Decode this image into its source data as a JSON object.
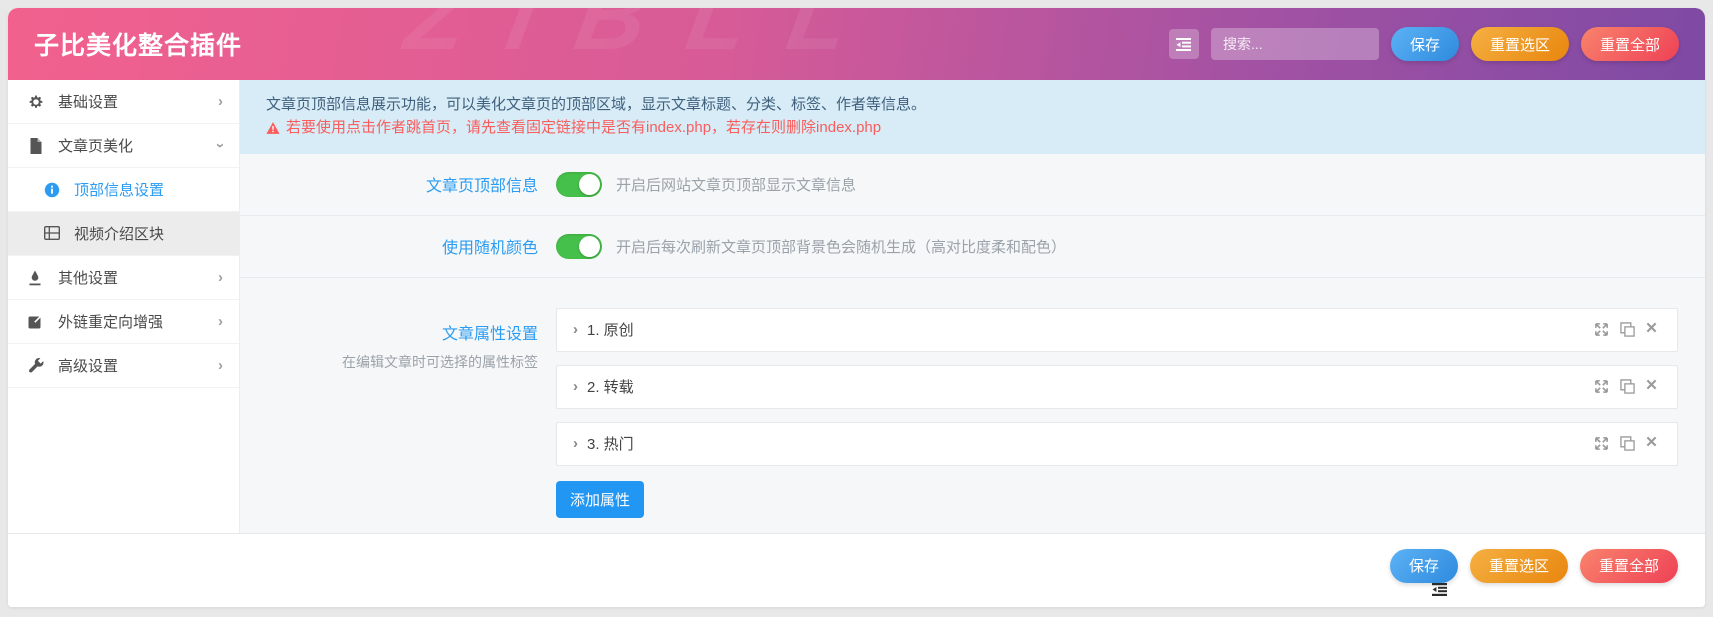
{
  "header": {
    "title": "子比美化整合插件",
    "watermark": "ZIBLL",
    "search_placeholder": "搜索...",
    "save": "保存",
    "reset_selection": "重置选区",
    "reset_all": "重置全部"
  },
  "sidebar": {
    "items": [
      {
        "label": "基础设置"
      },
      {
        "label": "文章页美化"
      },
      {
        "label": "顶部信息设置"
      },
      {
        "label": "视频介绍区块"
      },
      {
        "label": "其他设置"
      },
      {
        "label": "外链重定向增强"
      },
      {
        "label": "高级设置"
      }
    ]
  },
  "alert": {
    "info": "文章页顶部信息展示功能，可以美化文章页的顶部区域，显示文章标题、分类、标签、作者等信息。",
    "warning": "若要使用点击作者跳首页，请先查看固定链接中是否有index.php，若存在则删除index.php"
  },
  "settings": {
    "top_info": {
      "label": "文章页顶部信息",
      "desc": "开启后网站文章页顶部显示文章信息",
      "enabled": true
    },
    "random_color": {
      "label": "使用随机颜色",
      "desc": "开启后每次刷新文章页顶部背景色会随机生成（高对比度柔和配色）",
      "enabled": true
    },
    "attributes": {
      "label": "文章属性设置",
      "desc": "在编辑文章时可选择的属性标签",
      "items": [
        {
          "title": "1. 原创"
        },
        {
          "title": "2. 转载"
        },
        {
          "title": "3. 热门"
        }
      ],
      "add_label": "添加属性"
    }
  },
  "footer": {
    "save": "保存",
    "reset_selection": "重置选区",
    "reset_all": "重置全部"
  },
  "colors": {
    "header_gradient_start": "#f2618e",
    "header_gradient_end": "#7e4aa4",
    "save_blue": "#2e8add",
    "reset_orange": "#e8860e",
    "reset_red": "#ee4156",
    "toggle_green": "#45c04a",
    "link_blue": "#2b9cf2",
    "alert_bg": "#d7ecf6",
    "alert_text": "#41607d",
    "warning_red": "#f95d5d",
    "add_button_blue": "#2196f3"
  }
}
